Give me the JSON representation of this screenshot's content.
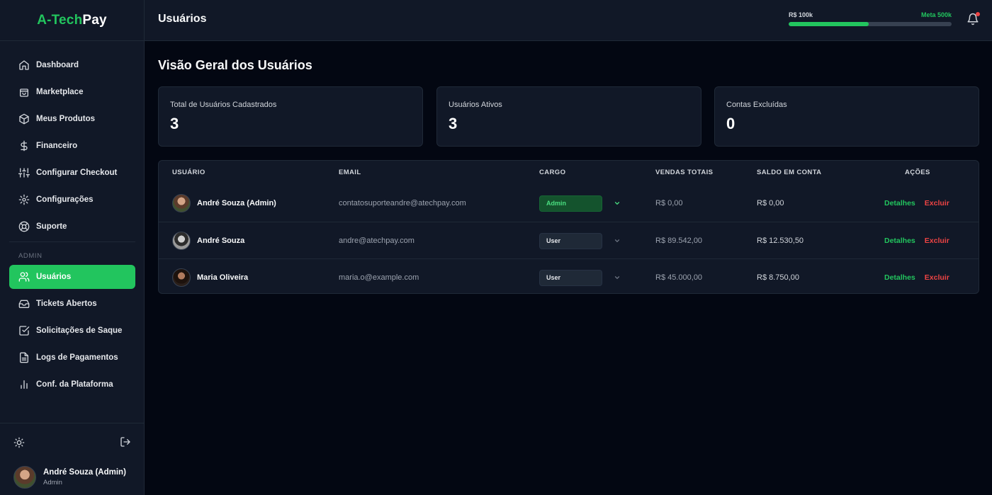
{
  "brand": {
    "part1": "A-Tech",
    "part2": "Pay",
    "accent": "#22c55e"
  },
  "sidebar": {
    "items": [
      {
        "label": "Dashboard",
        "icon": "home-icon"
      },
      {
        "label": "Marketplace",
        "icon": "shopping-bag-icon"
      },
      {
        "label": "Meus Produtos",
        "icon": "box-icon"
      },
      {
        "label": "Financeiro",
        "icon": "dollar-icon"
      },
      {
        "label": "Configurar Checkout",
        "icon": "sliders-icon"
      },
      {
        "label": "Configurações",
        "icon": "gear-icon"
      },
      {
        "label": "Suporte",
        "icon": "lifebuoy-icon"
      }
    ],
    "section_label": "ADMIN",
    "admin_items": [
      {
        "label": "Usuários",
        "icon": "users-icon",
        "active": true
      },
      {
        "label": "Tickets Abertos",
        "icon": "inbox-icon"
      },
      {
        "label": "Solicitações de Saque",
        "icon": "checkbox-icon"
      },
      {
        "label": "Logs de Pagamentos",
        "icon": "file-icon"
      },
      {
        "label": "Conf. da Plataforma",
        "icon": "bar-chart-icon"
      }
    ],
    "profile": {
      "name": "André Souza (Admin)",
      "role": "Admin"
    }
  },
  "header": {
    "title": "Usuários",
    "progress": {
      "left_label": "R$ 100k",
      "right_label": "Meta 500k",
      "fraction": 0.49
    }
  },
  "main": {
    "heading": "Visão Geral dos Usuários",
    "stats": [
      {
        "label": "Total de Usuários Cadastrados",
        "value": "3"
      },
      {
        "label": "Usuários Ativos",
        "value": "3"
      },
      {
        "label": "Contas Excluídas",
        "value": "0"
      }
    ],
    "table": {
      "headers": [
        "USUÁRIO",
        "EMAIL",
        "CARGO",
        "VENDAS TOTAIS",
        "SALDO EM CONTA",
        "AÇÕES"
      ],
      "rows": [
        {
          "name": "André Souza (Admin)",
          "email": "contatosuporteandre@atechpay.com",
          "role": "Admin",
          "sales": "R$ 0,00",
          "balance": "R$ 0,00",
          "details": "Detalhes",
          "delete": "Excluir"
        },
        {
          "name": "André Souza",
          "email": "andre@atechpay.com",
          "role": "User",
          "sales": "R$ 89.542,00",
          "balance": "R$ 12.530,50",
          "details": "Detalhes",
          "delete": "Excluir"
        },
        {
          "name": "Maria Oliveira",
          "email": "maria.o@example.com",
          "role": "User",
          "sales": "R$ 45.000,00",
          "balance": "R$ 8.750,00",
          "details": "Detalhes",
          "delete": "Excluir"
        }
      ]
    }
  }
}
